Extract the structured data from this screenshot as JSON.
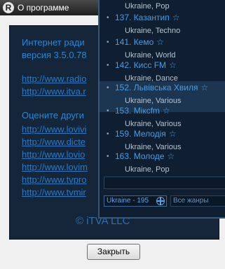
{
  "window": {
    "title": "О программе",
    "logo": "R"
  },
  "about": {
    "heading": "Интернет ради",
    "version": "версия 3.5.0.78",
    "links": [
      "http://www.radio",
      "http://www.itva.r"
    ],
    "others_heading": "Оцените други",
    "others_links": [
      "http://www.lovivi",
      "http://www.dicte",
      "http://www.lovio",
      "http://www.lovim",
      "http://www.tvpro",
      "http://www.tvmir"
    ],
    "copyright": "© iTVA LLC"
  },
  "buttons": {
    "close": "Закрыть"
  },
  "stations": {
    "first_sub": "Ukraine, Pop",
    "items": [
      {
        "name": "137. Казантип",
        "sub": "Ukraine, Techno"
      },
      {
        "name": "141. Кемо",
        "sub": "Ukraine, World"
      },
      {
        "name": "142. Кисс FM",
        "sub": "Ukraine, Dance"
      },
      {
        "name": "152. Львівська Хвиля",
        "sub": "Ukraine, Various",
        "active": true
      },
      {
        "name": "153. Мікcfm",
        "sub": "Ukraine, Various"
      },
      {
        "name": "159. Мелодія",
        "sub": "Ukraine, Various"
      },
      {
        "name": "163. Молоде",
        "sub": "Ukraine, Pop"
      }
    ],
    "country_filter": "Ukraine - 195",
    "genre_filter": "Все жанры"
  },
  "icons": {
    "bullet": "•",
    "star": "☆"
  },
  "colors": {
    "panel_bg": "#15253a",
    "link": "#2e78c2",
    "accent": "#4a9de6"
  }
}
